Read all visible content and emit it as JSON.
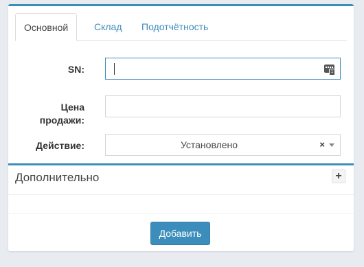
{
  "tabs": [
    {
      "label": "Основной",
      "active": true
    },
    {
      "label": "Склад",
      "active": false
    },
    {
      "label": "Подотчётность",
      "active": false
    }
  ],
  "form": {
    "sn_label": "SN:",
    "sn_value": "",
    "price_label_line1": "Цена",
    "price_label_line2": "продажи:",
    "price_value": "",
    "action_label": "Действие:",
    "action_value": "Установлено",
    "action_clear": "×"
  },
  "extra_panel": {
    "title": "Дополнительно",
    "toggle": "+"
  },
  "submit_label": "Добавить",
  "colors": {
    "accent": "#3c8dbc",
    "background": "#e8ecf1"
  },
  "icons": {
    "sn_field": "keyboard-icon",
    "action_dropdown": "chevron-down-icon",
    "action_clear": "close-icon",
    "panel_toggle": "plus-icon"
  }
}
